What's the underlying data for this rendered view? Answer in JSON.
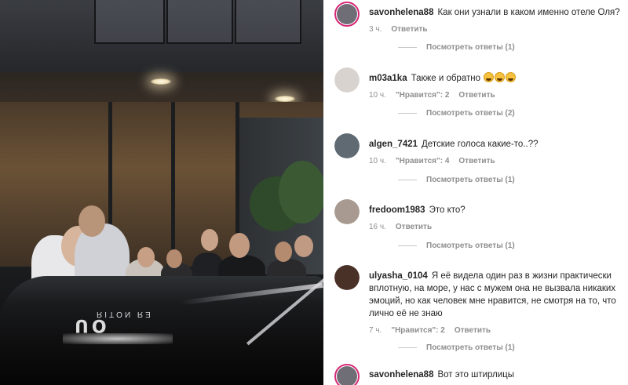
{
  "photo": {
    "car_emblem_text": "UO",
    "car_rear_text": "ЕЯ ИОТІЯ"
  },
  "comments": [
    {
      "username": "savonhelena88",
      "text": "Как они узнали в каком именно отеле Оля?",
      "time": "3 ч.",
      "likes": "",
      "reply_label": "Ответить",
      "view_replies": "Посмотреть ответы (1)",
      "avatar_color": "#6f6e76",
      "has_story_ring": true
    },
    {
      "username": "m03a1ka",
      "text": "Также и обратно",
      "emojis": [
        "face-with-tears-of-joy-icon",
        "face-with-tears-of-joy-icon",
        "face-with-tears-of-joy-icon"
      ],
      "time": "10 ч.",
      "likes": "\"Нравится\": 2",
      "reply_label": "Ответить",
      "view_replies": "Посмотреть ответы (2)",
      "avatar_color": "#d8d3ce",
      "has_story_ring": false
    },
    {
      "username": "algen_7421",
      "text": "Детские голоса какие-то..??",
      "time": "10 ч.",
      "likes": "\"Нравится\": 4",
      "reply_label": "Ответить",
      "view_replies": "Посмотреть ответы (1)",
      "avatar_color": "#5f6a73",
      "has_story_ring": false
    },
    {
      "username": "fredoom1983",
      "text": "Это кто?",
      "time": "16 ч.",
      "likes": "",
      "reply_label": "Ответить",
      "view_replies": "Посмотреть ответы (1)",
      "avatar_color": "#a89a90",
      "has_story_ring": false
    },
    {
      "username": "ulyasha_0104",
      "text": "Я её видела один раз в жизни практически вплотную, на море, у нас с мужем она не вызвала никаких эмоций, но как человек мне нравится, не смотря на то, что лично её не знаю",
      "time": "7 ч.",
      "likes": "\"Нравится\": 2",
      "reply_label": "Ответить",
      "view_replies": "Посмотреть ответы (1)",
      "avatar_color": "#4a3128",
      "has_story_ring": false
    },
    {
      "username": "savonhelena88",
      "text": "Вот это штирлицы",
      "time": "",
      "likes": "",
      "reply_label": "",
      "view_replies": "",
      "avatar_color": "#6f6e76",
      "has_story_ring": true
    }
  ]
}
